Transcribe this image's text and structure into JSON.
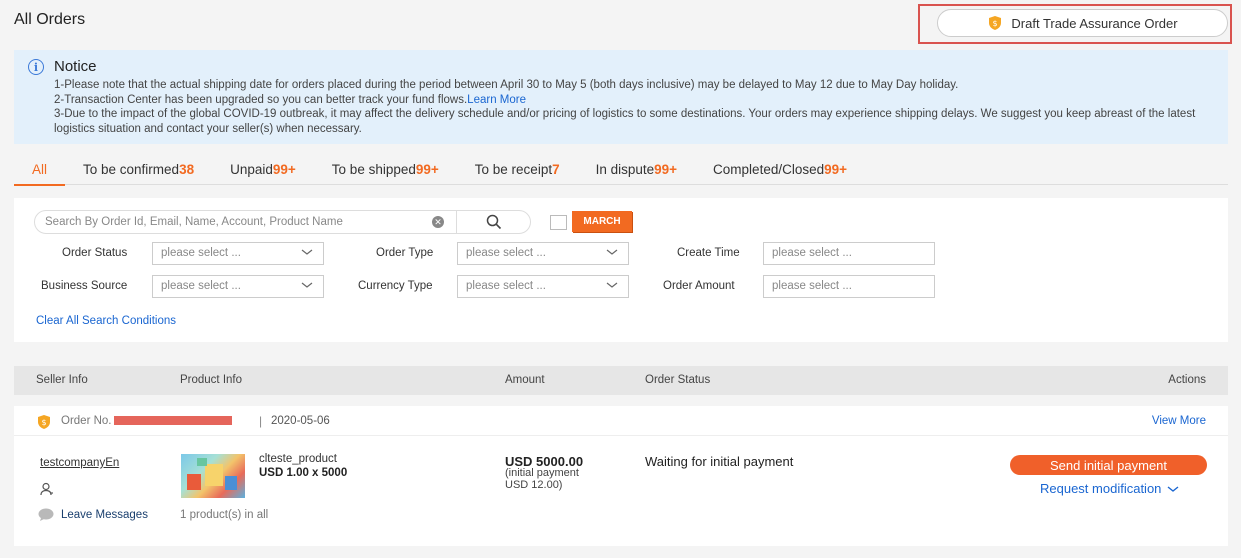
{
  "header": {
    "title": "All Orders",
    "draft_button": "Draft Trade Assurance Order"
  },
  "notice": {
    "title": "Notice",
    "line1": "1-Please note that the actual shipping date for orders placed during the period between April 30 to May 5 (both days inclusive) may be delayed to May 12 due to May Day holiday.",
    "line2": "2-Transaction Center has been upgraded so you can better track your fund flows.",
    "line2_link": "Learn More",
    "line3": "3-Due to the impact of the global COVID-19 outbreak, it may affect the delivery schedule and/or pricing of logistics to some destinations. Your orders may experience shipping delays. We suggest you keep abreast of the latest logistics situation and contact your seller(s) when necessary."
  },
  "tabs": [
    {
      "label": "All",
      "count": ""
    },
    {
      "label": "To be confirmed",
      "count": "38"
    },
    {
      "label": "Unpaid",
      "count": "99+"
    },
    {
      "label": "To be shipped",
      "count": "99+"
    },
    {
      "label": "To be receipt",
      "count": "7"
    },
    {
      "label": "In dispute",
      "count": "99+"
    },
    {
      "label": "Completed/Closed",
      "count": "99+"
    }
  ],
  "filters": {
    "search_placeholder": "Search By Order Id, Email, Name, Account, Product Name",
    "march_tag": "MARCH",
    "order_status_label": "Order Status",
    "order_type_label": "Order Type",
    "create_time_label": "Create Time",
    "business_source_label": "Business Source",
    "currency_type_label": "Currency Type",
    "order_amount_label": "Order Amount",
    "select_placeholder": "please select ...",
    "clear_all": "Clear All Search Conditions"
  },
  "table": {
    "columns": [
      "Seller Info",
      "Product Info",
      "Amount",
      "Order Status",
      "Actions"
    ]
  },
  "order": {
    "number_prefix": "Order No.",
    "date": "2020-05-06",
    "view_more": "View More",
    "seller": "testcompanyEn",
    "leave_messages": "Leave Messages",
    "product_name": "clteste_product",
    "product_qty": "USD 1.00 x 5000",
    "product_count": "1 product(s) in all",
    "amount": "USD 5000.00",
    "amount_sub1": "(initial payment",
    "amount_sub2": "USD 12.00)",
    "status": "Waiting for initial payment",
    "primary_action": "Send initial payment",
    "secondary_action": "Request modification"
  },
  "colors": {
    "accent": "#f26a21",
    "link": "#1a66d1",
    "notice_bg": "#e3f0fb"
  }
}
